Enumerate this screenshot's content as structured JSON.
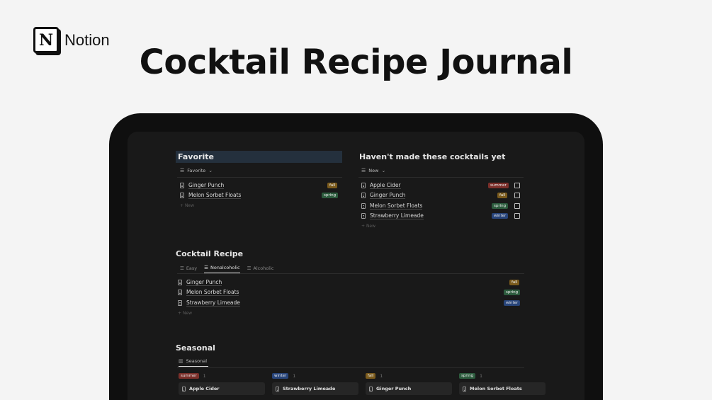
{
  "brand": {
    "name": "Notion",
    "logo_letter": "N"
  },
  "hero": {
    "title": "Cocktail Recipe Journal"
  },
  "favorite": {
    "title": "Favorite",
    "view_label": "Favorite",
    "items": [
      {
        "name": "Ginger Punch",
        "tag": "fall"
      },
      {
        "name": "Melon Sorbet Floats",
        "tag": "spring"
      }
    ],
    "new_label": "New"
  },
  "havent_made": {
    "title": "Haven't made these cocktails yet",
    "view_label": "New",
    "items": [
      {
        "name": "Apple Cider",
        "tag": "summer"
      },
      {
        "name": "Ginger Punch",
        "tag": "fall"
      },
      {
        "name": "Melon Sorbet Floats",
        "tag": "spring"
      },
      {
        "name": "Strawberry Limeade",
        "tag": "winter"
      }
    ],
    "new_label": "New"
  },
  "cocktail_recipe": {
    "title": "Cocktail Recipe",
    "tabs": [
      "Easy",
      "Nonalcoholic",
      "Alcoholic"
    ],
    "active_tab": "Nonalcoholic",
    "items": [
      {
        "name": "Ginger Punch",
        "tag": "fall"
      },
      {
        "name": "Melon Sorbet Floats",
        "tag": "spring"
      },
      {
        "name": "Strawberry Limeade",
        "tag": "winter"
      }
    ],
    "new_label": "New"
  },
  "seasonal": {
    "title": "Seasonal",
    "view_label": "Seasonal",
    "columns": [
      {
        "tag": "summer",
        "count": "1",
        "card": "Apple Cider"
      },
      {
        "tag": "winter",
        "count": "1",
        "card": "Strawberry Limeade"
      },
      {
        "tag": "fall",
        "count": "1",
        "card": "Ginger Punch"
      },
      {
        "tag": "spring",
        "count": "1",
        "card": "Melon Sorbet Floats"
      }
    ]
  },
  "colors": {
    "fall": "#7a5a1c",
    "spring": "#2d5c3e",
    "summer": "#7b2f2a",
    "winter": "#28457a"
  }
}
